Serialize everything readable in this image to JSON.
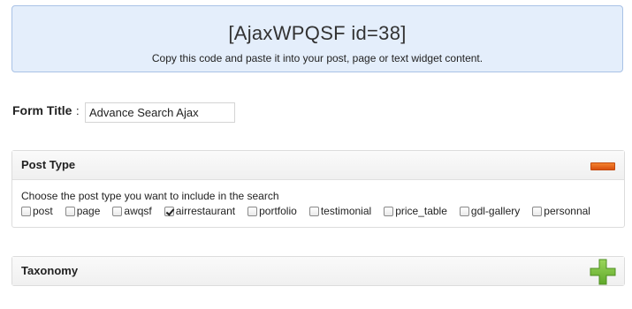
{
  "shortcode": {
    "code": "[AjaxWPQSF id=38]",
    "hint": "Copy this code and paste it into your post, page or text widget content."
  },
  "form_title": {
    "label": "Form Title",
    "colon": ":",
    "value": "Advance Search Ajax"
  },
  "post_type_panel": {
    "title": "Post Type",
    "toggle_icon": "minus-icon",
    "instruction": "Choose the post type you want to include in the search",
    "options": [
      {
        "label": "post",
        "checked": false
      },
      {
        "label": "page",
        "checked": false
      },
      {
        "label": "awqsf",
        "checked": false
      },
      {
        "label": "airrestaurant",
        "checked": true
      },
      {
        "label": "portfolio",
        "checked": false
      },
      {
        "label": "testimonial",
        "checked": false
      },
      {
        "label": "price_table",
        "checked": false
      },
      {
        "label": "gdl-gallery",
        "checked": false
      },
      {
        "label": "personnal",
        "checked": false
      }
    ]
  },
  "taxonomy_panel": {
    "title": "Taxonomy",
    "toggle_icon": "plus-icon"
  },
  "colors": {
    "shortcode_bg": "#e4eefb",
    "shortcode_border": "#a9c2e6",
    "minus_icon": "#e8631c",
    "plus_icon": "#7bc043"
  }
}
